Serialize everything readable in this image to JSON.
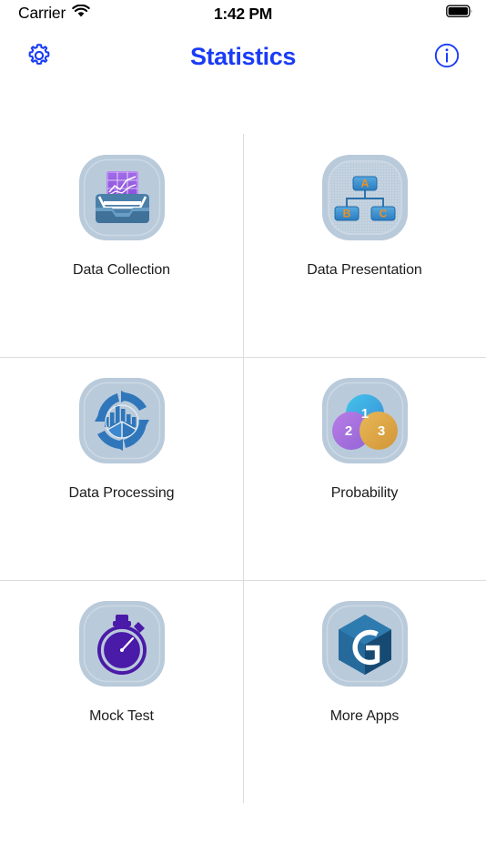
{
  "status_bar": {
    "carrier": "Carrier",
    "wifi_icon": "wifi-icon",
    "time": "1:42 PM",
    "battery_icon": "battery-full-icon"
  },
  "nav_bar": {
    "settings_icon": "gear-icon",
    "title": "Statistics",
    "info_icon": "info-circle-icon",
    "title_color": "#1a3cf5",
    "icon_color": "#1a3cf5"
  },
  "grid": {
    "tiles": [
      {
        "label": "Data Collection",
        "icon": "inbox-chart-icon"
      },
      {
        "label": "Data Presentation",
        "icon": "org-chart-icon"
      },
      {
        "label": "Data Processing",
        "icon": "recycle-charts-icon"
      },
      {
        "label": "Probability",
        "icon": "venn-diagram-icon"
      },
      {
        "label": "Mock Test",
        "icon": "stopwatch-icon"
      },
      {
        "label": "More Apps",
        "icon": "hexagon-g-cube-icon"
      }
    ],
    "org_chart_nodes": [
      "A",
      "B",
      "C"
    ],
    "venn_labels": [
      "1",
      "2",
      "3"
    ],
    "divider_color": "#dcdcdc",
    "label_color": "#1c1c1e",
    "tile_tile_bg": "#b9cada"
  }
}
